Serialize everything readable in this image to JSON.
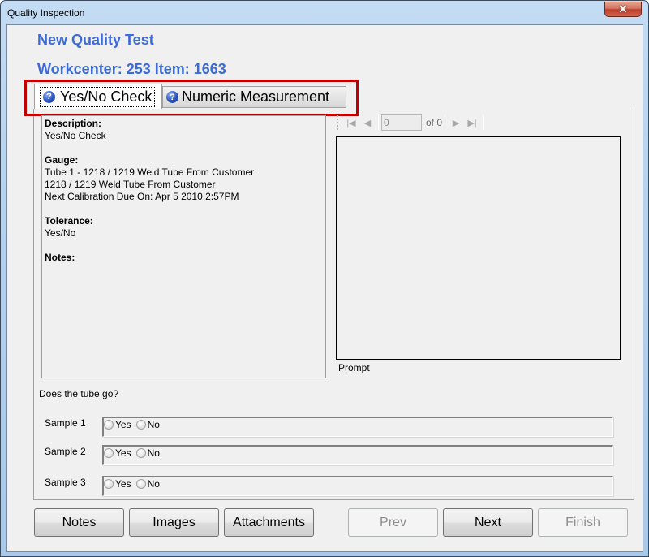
{
  "window": {
    "title": "Quality Inspection",
    "close_icon": "close-icon"
  },
  "header": {
    "title": "New Quality Test",
    "subtitle": "Workcenter: 253 Item: 1663",
    "title_color": "#3b6ad9"
  },
  "tabs": [
    {
      "label": "Yes/No Check",
      "icon": "help-icon",
      "active": true
    },
    {
      "label": "Numeric Measurement",
      "icon": "help-icon",
      "active": false
    }
  ],
  "highlight_color": "#c00000",
  "details": {
    "description_label": "Description:",
    "description_value": "Yes/No Check",
    "gauge_label": "Gauge:",
    "gauge_lines": [
      "Tube 1 - 1218 / 1219 Weld Tube From Customer",
      "1218 / 1219 Weld Tube From Customer",
      "Next Calibration Due On: Apr 5 2010 2:57PM"
    ],
    "tolerance_label": "Tolerance:",
    "tolerance_value": "Yes/No",
    "notes_label": "Notes:"
  },
  "navigator": {
    "position_value": "0",
    "of_text": "of 0",
    "first_icon": "first-page-icon",
    "prev_icon": "prev-page-icon",
    "next_icon": "next-page-icon",
    "last_icon": "last-page-icon"
  },
  "prompt": {
    "label": "Prompt"
  },
  "question": "Does the tube go?",
  "samples": [
    {
      "label": "Sample 1",
      "options": [
        "Yes",
        "No"
      ]
    },
    {
      "label": "Sample 2",
      "options": [
        "Yes",
        "No"
      ]
    },
    {
      "label": "Sample 3",
      "options": [
        "Yes",
        "No"
      ]
    }
  ],
  "buttons": {
    "notes": "Notes",
    "images": "Images",
    "attachments": "Attachments",
    "prev": "Prev",
    "next": "Next",
    "finish": "Finish"
  }
}
